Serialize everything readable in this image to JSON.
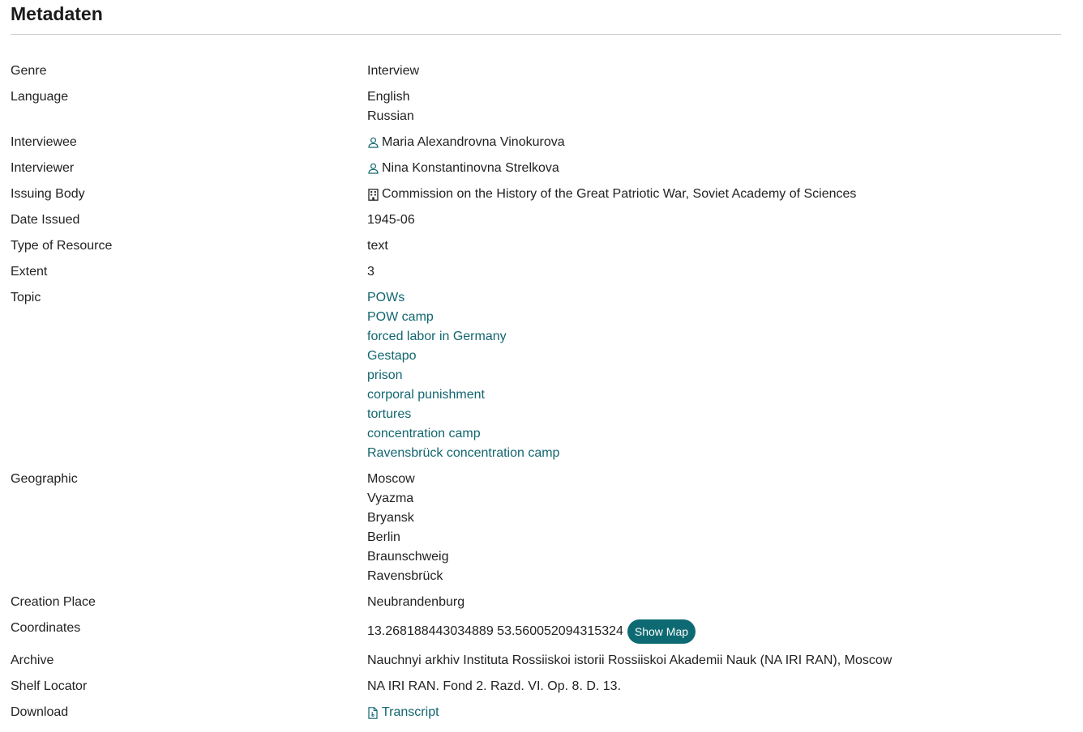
{
  "heading": "Metadaten",
  "colors": {
    "link": "#12666f",
    "button": "#0e6a72",
    "rule": "#cfcfcf"
  },
  "fields": {
    "genre": {
      "label": "Genre",
      "values": [
        "Interview"
      ]
    },
    "language": {
      "label": "Language",
      "values": [
        "English",
        "Russian"
      ]
    },
    "interviewee": {
      "label": "Interviewee",
      "value": "Maria Alexandrovna Vinokurova",
      "icon": "person-icon"
    },
    "interviewer": {
      "label": "Interviewer",
      "value": "Nina Konstantinovna Strelkova",
      "icon": "person-icon"
    },
    "issuing_body": {
      "label": "Issuing Body",
      "value": "Commission on the History of the Great Patriotic War, Soviet Academy of Sciences",
      "icon": "building-icon"
    },
    "date_issued": {
      "label": "Date Issued",
      "value": "1945-06"
    },
    "type_of_resource": {
      "label": "Type of Resource",
      "value": "text"
    },
    "extent": {
      "label": "Extent",
      "value": "3"
    },
    "topic": {
      "label": "Topic",
      "links": [
        "POWs",
        "POW camp",
        "forced labor in Germany",
        "Gestapo",
        "prison",
        "corporal punishment",
        "tortures",
        "concentration camp",
        "Ravensbrück concentration camp"
      ]
    },
    "geographic": {
      "label": "Geographic",
      "values": [
        "Moscow",
        "Vyazma",
        "Bryansk",
        "Berlin",
        "Braunschweig",
        "Ravensbrück"
      ]
    },
    "creation_place": {
      "label": "Creation Place",
      "value": "Neubrandenburg"
    },
    "coordinates": {
      "label": "Coordinates",
      "value": "13.268188443034889 53.560052094315324",
      "button": "Show Map"
    },
    "archive": {
      "label": "Archive",
      "value": "Nauchnyi arkhiv Instituta Rossiiskoi istorii Rossiiskoi Akademii Nauk (NA IRI RAN), Moscow"
    },
    "shelf_locator": {
      "label": "Shelf Locator",
      "value": "NA IRI RAN. Fond 2. Razd. VI. Op. 8. D. 13."
    },
    "download": {
      "label": "Download",
      "link": "Transcript",
      "icon": "file-icon"
    }
  }
}
